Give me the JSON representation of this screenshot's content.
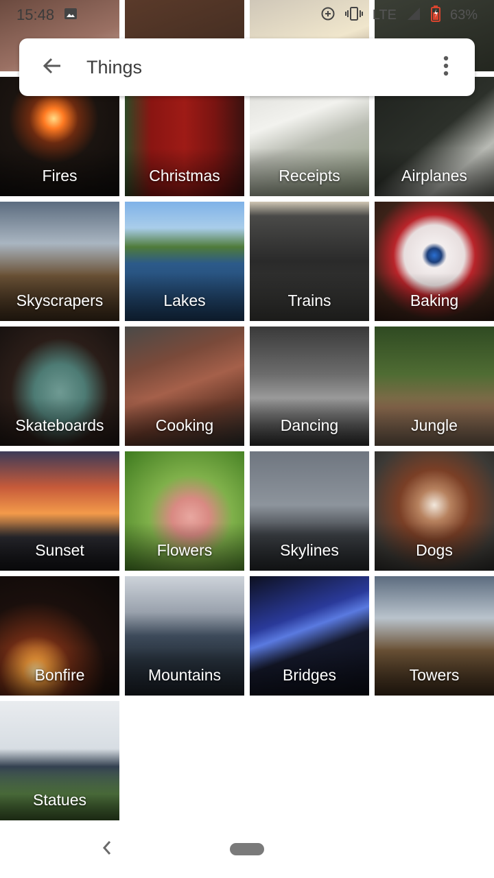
{
  "status_bar": {
    "time": "15:48",
    "network": "LTE",
    "battery": "63%",
    "icons": [
      "image-icon",
      "data-saver-icon",
      "vibrate-icon",
      "signal-icon",
      "battery-icon"
    ]
  },
  "header": {
    "title": "Things",
    "back_icon": "arrow-left-icon",
    "more_icon": "more-vert-icon"
  },
  "categories": [
    {
      "label": "Fires"
    },
    {
      "label": "Christmas"
    },
    {
      "label": "Receipts"
    },
    {
      "label": "Airplanes"
    },
    {
      "label": "Skyscrapers"
    },
    {
      "label": "Lakes"
    },
    {
      "label": "Trains"
    },
    {
      "label": "Baking"
    },
    {
      "label": "Skateboards"
    },
    {
      "label": "Cooking"
    },
    {
      "label": "Dancing"
    },
    {
      "label": "Jungle"
    },
    {
      "label": "Sunset"
    },
    {
      "label": "Flowers"
    },
    {
      "label": "Skylines"
    },
    {
      "label": "Dogs"
    },
    {
      "label": "Bonfire"
    },
    {
      "label": "Mountains"
    },
    {
      "label": "Bridges"
    },
    {
      "label": "Towers"
    },
    {
      "label": "Statues"
    }
  ],
  "nav_bar": {
    "back_icon": "chevron-left-icon",
    "home_icon": "home-pill-icon"
  },
  "colors": {
    "accent_text": "#3c3c3c",
    "label_text": "#ffffff"
  }
}
